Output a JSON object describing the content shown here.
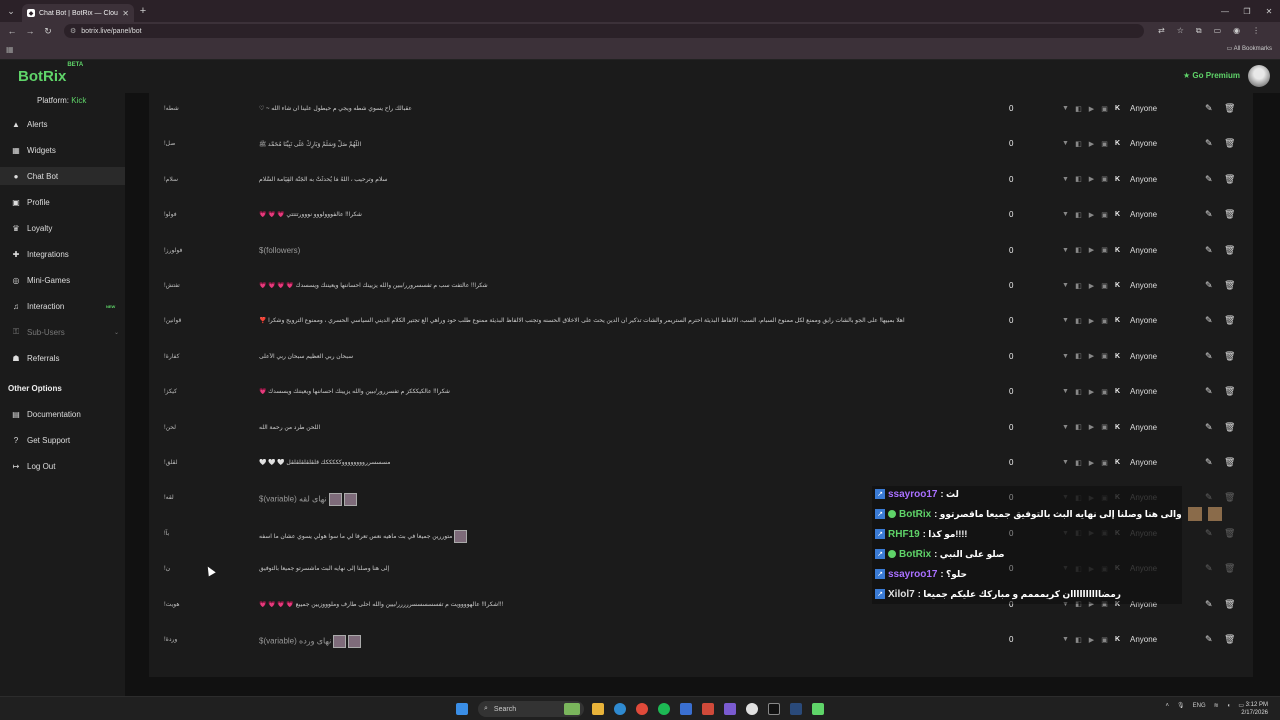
{
  "browser": {
    "tab_title": "Chat Bot | BotRix — Cloud Strea",
    "url": "botrix.live/panel/bot",
    "all_bookmarks": "All Bookmarks"
  },
  "header": {
    "logo": "BotRix",
    "logo_badge": "BETA",
    "premium": "Go Premium"
  },
  "sidebar": {
    "platform_label": "Platform:",
    "platform_value": "Kick",
    "items": [
      {
        "label": "Alerts",
        "icon": "bell-icon"
      },
      {
        "label": "Widgets",
        "icon": "grid-icon"
      },
      {
        "label": "Chat Bot",
        "icon": "robot-icon"
      },
      {
        "label": "Profile",
        "icon": "profile-icon"
      },
      {
        "label": "Loyalty",
        "icon": "trophy-icon"
      },
      {
        "label": "Integrations",
        "icon": "puzzle-icon"
      },
      {
        "label": "Mini-Games",
        "icon": "gamepad-icon"
      },
      {
        "label": "Interaction",
        "icon": "music-icon",
        "badge": "NEW"
      },
      {
        "label": "Sub-Users",
        "icon": "lock-icon"
      },
      {
        "label": "Referrals",
        "icon": "users-icon"
      }
    ],
    "other_options": "Other Options",
    "other_items": [
      {
        "label": "Documentation",
        "icon": "book-icon"
      },
      {
        "label": "Get Support",
        "icon": "question-icon"
      },
      {
        "label": "Log Out",
        "icon": "logout-icon"
      }
    ]
  },
  "commands": {
    "permission": "Anyone",
    "rows": [
      {
        "cmd": "!شطه",
        "resp": "♡ ~ عقبالك راح يسوي شطه ويجي م حيطول علينا ان شاء الله",
        "count": "0"
      },
      {
        "cmd": "!صل",
        "resp": "اللَّهُمَّ صَلِّ وَسَلِّمْ وَبَارِكْ عَلَى نَبِيِّنَا مُحَمَّد ﷺ",
        "count": "0"
      },
      {
        "cmd": "!سلام",
        "resp": "سلام وترحيب ، اَلْلَّهُ مَا يُحدثُتْ به الْجَنَّة الْقِيَامة الْسَّلام",
        "count": "0"
      },
      {
        "cmd": "!فولو",
        "resp": "💗 💗 💗 شكراً!! عالفووولووو نووورتتتتي",
        "count": "0"
      },
      {
        "cmd": "!فولورز",
        "resp": "$(followers)",
        "count": "0",
        "var": true
      },
      {
        "cmd": "!تفتش",
        "resp": "💗 💗 💗 💗 شكراً!! عالتفت سب م تفسسرورر/ببين والله يزيينك احساننها ويعيننك ويسسدك",
        "count": "0"
      },
      {
        "cmd": "!قوانين",
        "resp": "❣️ اهلا بمبيها! على الجو بالشات رايق وممنع لكل ممنوع السبام، السب، الالفاظ البذيئة احترم الستريمر والشات تذكير ان الدين يحث على الاخلاق الحسنه وتجنب الالفاظ البذيئة ممنوع طلب حود وراهي الع تجتير الكلام الديني السياسي الحسري ، وممنوع الترويج وشكرا",
        "count": "0"
      },
      {
        "cmd": "!كفارة",
        "resp": "سبحان ربي العظيم سبحان ربي الأعلى",
        "count": "0"
      },
      {
        "cmd": "!كيكز",
        "resp": "💗 شكراً!! عالكيكككز م تفسررور/ببين والله يزيينك احساننها ويعيننك ويسسدك",
        "count": "0"
      },
      {
        "cmd": "!لحن",
        "resp": "اللحن طرد من رحمة الله",
        "count": "0"
      },
      {
        "cmd": "!لقلق",
        "resp": "🤍 🤍 🤍 مسسسررووووووووكككككك قلقلقلقلقلقل",
        "count": "0"
      },
      {
        "cmd": "!لقه",
        "resp": "$(variable) نهاى لقه",
        "count": "0",
        "var": true,
        "emotes": 2
      },
      {
        "cmd": "!بآ",
        "resp": "متوررين جميعا في بث ماهيه نعس تعرفا لي ما سوا هولي يسوي عشان ما اسفه",
        "count": "0",
        "emotes": 1
      },
      {
        "cmd": "!ن",
        "resp": "إلى هنا وصلنا إلى نهايه البث ماشسرتو جميعا بالتوفيق",
        "count": "0"
      },
      {
        "cmd": "!هويت",
        "resp": "💗 💗 💗 💗 شكراً!! عالهوووويت م تفسسسسسررررر/بيين والله احلى طارف وملوووزيين جمييع!!!",
        "count": "0"
      },
      {
        "cmd": "!وردة",
        "resp": "$(variable) نهاى ورده",
        "count": "0",
        "var": true,
        "emotes": 2
      }
    ]
  },
  "chat_overlay": [
    {
      "user": "ssayroo17",
      "color": "#a970ff",
      "msg": ": لث"
    },
    {
      "user": "BotRix",
      "color": "#5fd469",
      "msg": ": والى هنا وصلنا إلى نهايه البث بالتوفيق جميعا ماقصرتوو",
      "bot": true,
      "emotes": 2
    },
    {
      "user": "RHF19",
      "color": "#5fd469",
      "msg": ": مو كذا!!!!"
    },
    {
      "user": "BotRix",
      "color": "#5fd469",
      "msg": ": صلو على النبي",
      "bot": true
    },
    {
      "user": "ssayroo17",
      "color": "#a970ff",
      "msg": ": حلو؟"
    },
    {
      "user": "Xilol7",
      "color": "#e0e0e0",
      "msg": ": رمضاااااااااان كريمممم و مباركك عليكم جميعا"
    }
  ],
  "taskbar": {
    "search": "Search",
    "lang": "ENG",
    "time": "3:12 PM",
    "date": "2/17/2026"
  },
  "colors": {
    "accent": "#5fd469",
    "background": "#141414",
    "panel": "#1b1b1b"
  }
}
